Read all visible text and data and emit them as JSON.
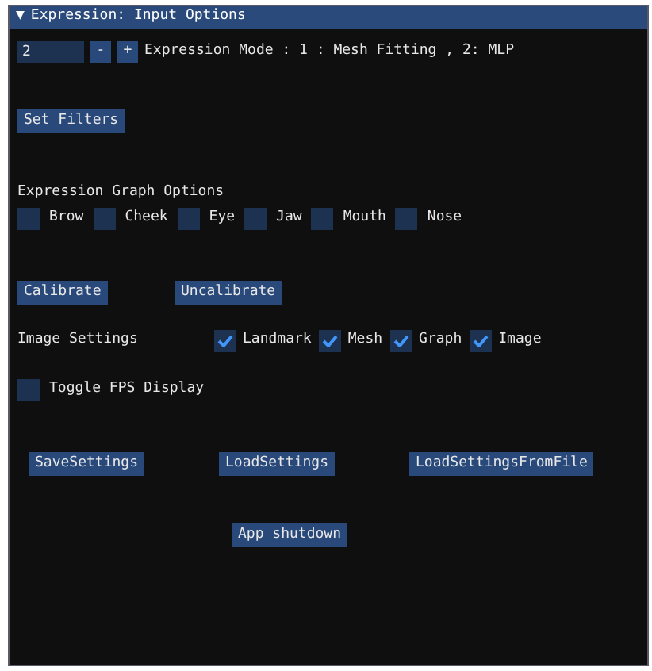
{
  "window": {
    "arrow": "▼",
    "title": "Expression: Input Options"
  },
  "mode_input": {
    "value": "2",
    "decrement": "-",
    "increment": "+",
    "label": "Expression Mode : 1 : Mesh Fitting , 2: MLP"
  },
  "set_filters_button": "Set Filters",
  "graph_options": {
    "heading": "Expression Graph Options",
    "checkboxes": [
      {
        "label": "Brow",
        "checked": false
      },
      {
        "label": "Cheek",
        "checked": false
      },
      {
        "label": "Eye",
        "checked": false
      },
      {
        "label": "Jaw",
        "checked": false
      },
      {
        "label": "Mouth",
        "checked": false
      },
      {
        "label": "Nose",
        "checked": false
      }
    ]
  },
  "calibration_buttons": [
    "Calibrate",
    "Uncalibrate"
  ],
  "image_settings": {
    "label": "Image Settings",
    "checkboxes": [
      {
        "label": "Landmark",
        "checked": true
      },
      {
        "label": "Mesh",
        "checked": true
      },
      {
        "label": "Graph",
        "checked": true
      },
      {
        "label": "Image",
        "checked": true
      }
    ]
  },
  "fps_toggle": {
    "label": "Toggle FPS Display",
    "checked": false
  },
  "settings_buttons": [
    "SaveSettings",
    "LoadSettings",
    "LoadSettingsFromFile"
  ],
  "shutdown_button": "App shutdown"
}
